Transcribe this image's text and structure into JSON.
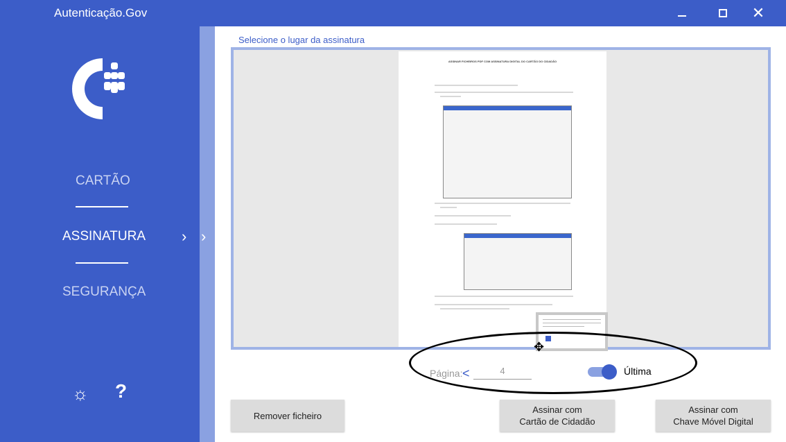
{
  "window": {
    "title": "Autenticação.Gov",
    "minimize_icon": "minimize-icon",
    "maximize_icon": "maximize-icon",
    "close_glyph": "✕"
  },
  "sidebar": {
    "items": [
      {
        "label": "CARTÃO",
        "active": false
      },
      {
        "label": "ASSINATURA",
        "active": true
      },
      {
        "label": "SEGURANÇA",
        "active": false
      }
    ],
    "active_chevron": "›",
    "strip_chevron": "›",
    "settings_glyph": "☼",
    "help_label": "?"
  },
  "main": {
    "section_title": "Selecione o lugar da assinatura",
    "pdf_preview": {
      "heading": "ASSINAR FICHEIROS PDF COM ASSINATURA DIGITAL DO CARTÃO DO CIDADÃO"
    },
    "move_glyph": "✥",
    "pagination": {
      "label": "Página:",
      "prev": "<",
      "value": "4"
    },
    "last_page_toggle": {
      "label": "Última",
      "on": true
    }
  },
  "buttons": {
    "remove": "Remover ficheiro",
    "sign_cc_line1": "Assinar com",
    "sign_cc_line2": "Cartão de Cidadão",
    "sign_cmd_line1": "Assinar com",
    "sign_cmd_line2": "Chave Móvel Digital"
  },
  "colors": {
    "primary": "#3c5dc8",
    "accent_light": "#8aa1e1",
    "button_bg": "#dcdcdc"
  }
}
